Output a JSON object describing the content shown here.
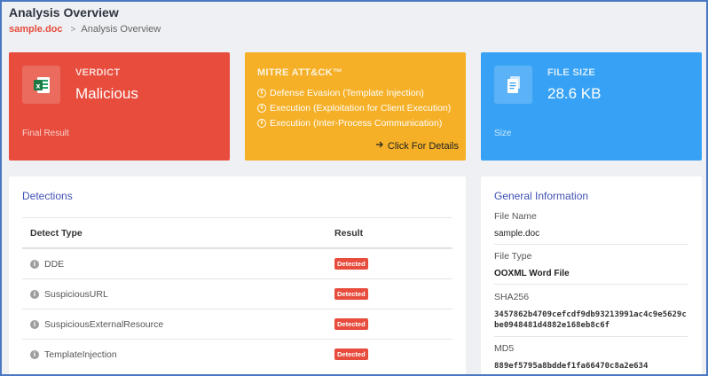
{
  "page": {
    "title": "Analysis Overview",
    "breadcrumb": {
      "file": "sample.doc",
      "separator": ">",
      "current": "Analysis Overview"
    }
  },
  "cards": {
    "verdict": {
      "label": "VERDICT",
      "value": "Malicious",
      "footer": "Final Result",
      "icon": "excel-file-icon",
      "color": "#e74c3c"
    },
    "mitre": {
      "label": "MITRE ATT&CK™",
      "items": [
        "Defense Evasion (Template Injection)",
        "Execution (Exploitation for Client Execution)",
        "Execution (Inter-Process Communication)"
      ],
      "link": "Click For Details",
      "color": "#f5b027"
    },
    "filesize": {
      "label": "FILE SIZE",
      "value": "28.6 KB",
      "footer": "Size",
      "icon": "document-icon",
      "color": "#37a2f5"
    }
  },
  "detections": {
    "title": "Detections",
    "columns": [
      "Detect Type",
      "Result"
    ],
    "rows": [
      {
        "type": "DDE",
        "result": "Detected"
      },
      {
        "type": "SuspiciousURL",
        "result": "Detected"
      },
      {
        "type": "SuspiciousExternalResource",
        "result": "Detected"
      },
      {
        "type": "TemplateInjection",
        "result": "Detected"
      }
    ]
  },
  "general": {
    "title": "General Information",
    "fields": [
      {
        "label": "File Name",
        "value": "sample.doc"
      },
      {
        "label": "File Type",
        "value": "OOXML Word File"
      },
      {
        "label": "SHA256",
        "value": "3457862b4709cefcdf9db93213991ac4c9e5629cbe0948481d4882e168eb8c6f"
      },
      {
        "label": "MD5",
        "value": "889ef5795a8bddef1fa66470c8a2e634"
      }
    ]
  }
}
